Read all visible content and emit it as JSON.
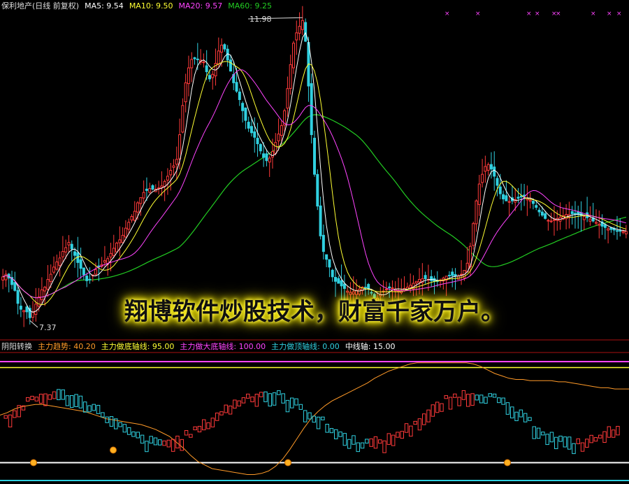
{
  "colors": {
    "background": "#000000",
    "up": "#ff3a3a",
    "down": "#30d0e0",
    "ma5": "#ffffff",
    "ma10": "#ffff33",
    "ma20": "#ff44ff",
    "ma60": "#22cc22",
    "trend": "#ff9a28",
    "bottom_axis": "#ffff33",
    "big_bottom": "#ff44ff",
    "top_axis": "#30d0e0",
    "mid_axis": "#ffffff",
    "separator": "#aa1111"
  },
  "top_legend": {
    "title": "保利地产(日线 前复权)",
    "ma5_label": "MA5: 9.54",
    "ma10_label": "MA10: 9.50",
    "ma20_label": "MA20: 9.57",
    "ma60_label": "MA60: 9.25"
  },
  "price_labels": {
    "high": "11.98",
    "low": "7.37"
  },
  "caption": "翔博软件炒股技术，财富千家万户。",
  "bottom_legend": {
    "name": "阴阳转换",
    "trend": "主力趋势: 40.20",
    "bottom_axis": "主力做底轴线: 95.00",
    "big_bottom_axis": "主力做大底轴线: 100.00",
    "top_axis": "主力做顶轴线: 0.00",
    "mid_axis": "中线轴: 15.00"
  },
  "chart_data": [
    {
      "type": "candlestick",
      "title": "保利地产(日线 前复权)",
      "ylim": [
        7.2,
        12.05
      ],
      "annotations": [
        "11.98",
        "7.37"
      ],
      "legend": [
        "MA5: 9.54",
        "MA10: 9.50",
        "MA20: 9.57",
        "MA60: 9.25"
      ],
      "closes": [
        8.0,
        8.04,
        7.98,
        7.88,
        7.79,
        7.59,
        7.5,
        7.48,
        7.46,
        7.37,
        7.46,
        7.58,
        7.69,
        7.8,
        7.84,
        7.96,
        8.04,
        8.15,
        8.23,
        8.29,
        8.39,
        8.45,
        8.53,
        8.43,
        8.33,
        8.22,
        8.13,
        8.03,
        7.94,
        7.96,
        8.03,
        8.11,
        8.15,
        8.19,
        8.25,
        8.28,
        8.36,
        8.44,
        8.52,
        8.57,
        8.64,
        8.75,
        8.84,
        8.93,
        9.01,
        9.14,
        9.22,
        9.3,
        9.33,
        9.36,
        9.35,
        9.35,
        9.37,
        9.4,
        9.47,
        9.55,
        9.64,
        9.71,
        9.81,
        10.19,
        10.64,
        10.99,
        11.22,
        11.35,
        11.36,
        11.35,
        11.34,
        11.31,
        11.16,
        11.05,
        11.12,
        11.29,
        11.48,
        11.57,
        11.51,
        11.34,
        11.17,
        10.99,
        10.86,
        10.73,
        10.56,
        10.41,
        10.29,
        10.22,
        10.15,
        10.05,
        9.94,
        9.84,
        9.79,
        9.83,
        9.93,
        10.07,
        10.2,
        10.33,
        10.56,
        10.9,
        11.27,
        11.6,
        11.76,
        11.86,
        11.95,
        11.63,
        10.94,
        10.19,
        9.58,
        9.09,
        8.63,
        8.39,
        8.27,
        8.15,
        8.0,
        7.93,
        7.9,
        7.86,
        7.82,
        7.78,
        7.76,
        7.77,
        7.79,
        7.81,
        7.84,
        7.83,
        7.81,
        7.75,
        7.68,
        7.67,
        7.73,
        7.78,
        7.81,
        7.83,
        7.83,
        7.81,
        7.79,
        7.79,
        7.82,
        7.84,
        7.87,
        7.9,
        7.93,
        7.96,
        7.97,
        7.97,
        7.96,
        7.94,
        7.93,
        7.93,
        7.95,
        7.98,
        8.01,
        8.02,
        8.02,
        8.01,
        8.01,
        8.04,
        8.1,
        8.21,
        8.47,
        8.82,
        9.17,
        9.43,
        9.58,
        9.7,
        9.73,
        9.66,
        9.55,
        9.41,
        9.28,
        9.2,
        9.17,
        9.16,
        9.17,
        9.19,
        9.21,
        9.23,
        9.24,
        9.21,
        9.18,
        9.13,
        9.07,
        9.0,
        8.95,
        8.9,
        8.87,
        8.86,
        8.88,
        8.9,
        8.92,
        8.94,
        8.96,
        8.96,
        8.97,
        8.97,
        8.96,
        8.94,
        8.93,
        8.91,
        8.89,
        8.86,
        8.84,
        8.81,
        8.78,
        8.76,
        8.74,
        8.73,
        8.72,
        8.71,
        8.71,
        8.7,
        8.7
      ]
    },
    {
      "type": "line",
      "title": "阴阳转换",
      "ylim": [
        0,
        100
      ],
      "series": [
        {
          "name": "主力趋势",
          "values": [
            55,
            57,
            60,
            62,
            63,
            64,
            64,
            63,
            62,
            61,
            60,
            59,
            58,
            56,
            54,
            52,
            51,
            50,
            49,
            48,
            47,
            45,
            43,
            40,
            37,
            32,
            27,
            21,
            16,
            13,
            10,
            9,
            8,
            7,
            6,
            5,
            5,
            6,
            8,
            12,
            18,
            26,
            35,
            44,
            52,
            58,
            63,
            67,
            70,
            73,
            76,
            79,
            82,
            86,
            89,
            92,
            94,
            96,
            98,
            99,
            99,
            99,
            99,
            99,
            99,
            99,
            99,
            98,
            96,
            93,
            90,
            88,
            86,
            85,
            85,
            84,
            84,
            84,
            84,
            83,
            83,
            82,
            81,
            80,
            79,
            78,
            78,
            77,
            77,
            77
          ]
        },
        {
          "name": "主力做底轴线",
          "values": [
            95,
            95
          ]
        },
        {
          "name": "主力做大底轴线",
          "values": [
            100,
            100
          ]
        },
        {
          "name": "主力做顶轴线",
          "values": [
            0,
            0
          ]
        },
        {
          "name": "中线轴",
          "values": [
            15,
            15
          ]
        }
      ]
    }
  ]
}
